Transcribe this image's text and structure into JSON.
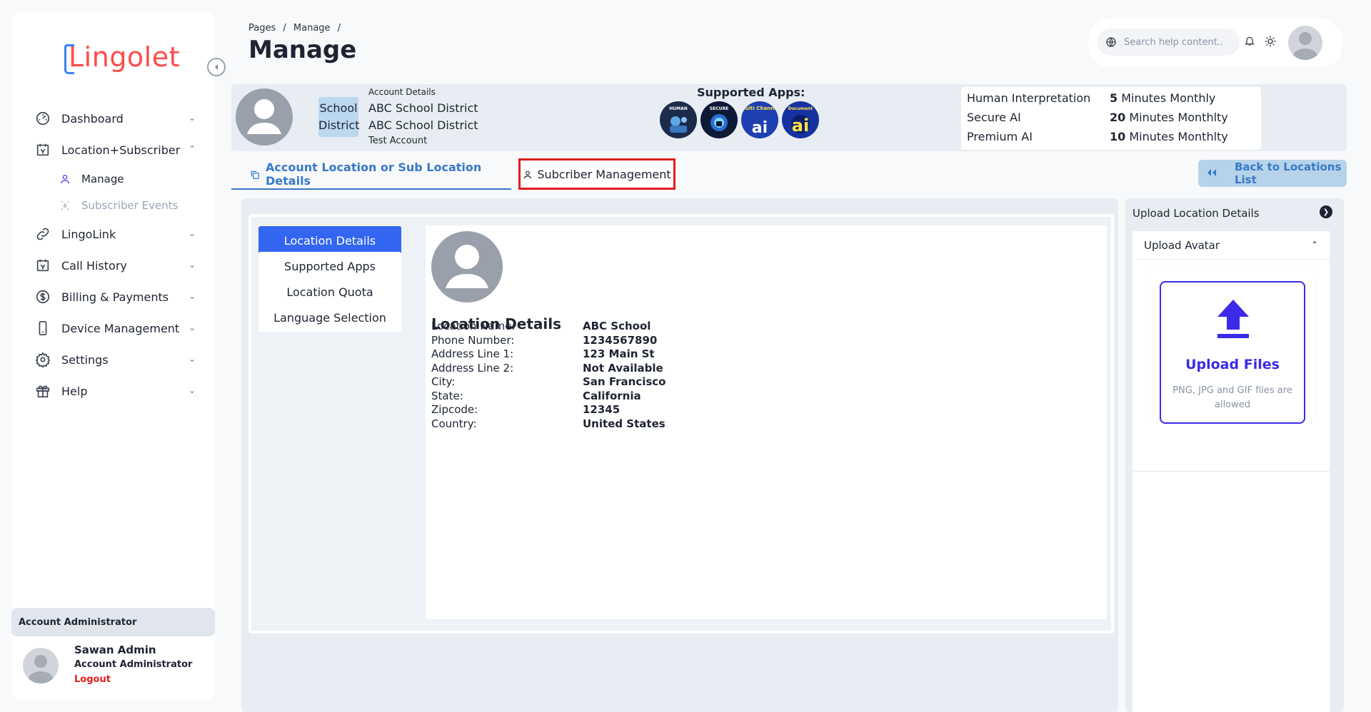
{
  "brand": {
    "logo_text": "Lingolet"
  },
  "sidebar": {
    "items": [
      {
        "label": "Dashboard",
        "icon": "gauge-icon",
        "expanded": false
      },
      {
        "label": "Location+Subscriber",
        "icon": "calendar-icon",
        "expanded": true
      },
      {
        "label": "LingoLink",
        "icon": "link-icon",
        "expanded": false
      },
      {
        "label": "Call History",
        "icon": "calendar-icon",
        "expanded": false
      },
      {
        "label": "Billing & Payments",
        "icon": "dollar-icon",
        "expanded": false
      },
      {
        "label": "Device Management",
        "icon": "phone-icon",
        "expanded": false
      },
      {
        "label": "Settings",
        "icon": "gear-icon",
        "expanded": false
      },
      {
        "label": "Help",
        "icon": "gift-icon",
        "expanded": false
      }
    ],
    "sub_items": [
      {
        "label": "Manage",
        "icon": "user-icon",
        "active": true
      },
      {
        "label": "Subscriber Events",
        "icon": "list-icon",
        "active": false
      }
    ],
    "role_label": "Account Administrator",
    "user": {
      "name": "Sawan Admin",
      "role": "Account Administrator",
      "logout": "Logout"
    }
  },
  "header": {
    "breadcrumb": [
      "Pages",
      "/",
      "Manage",
      "/"
    ],
    "title": "Manage",
    "search_placeholder": "Search help content.."
  },
  "account": {
    "type_line1": "School",
    "type_line2": "District",
    "details_label": "Account Details",
    "name_line1": "ABC School District",
    "name_line2": "ABC School District",
    "account_kind": "Test Account",
    "supported_apps_title": "Supported Apps:",
    "apps": [
      {
        "label": "HUMAN",
        "color": "#1c2b4a"
      },
      {
        "label": "SECURE",
        "color": "#0c1a36"
      },
      {
        "label": "ai",
        "top": "Multi Channel",
        "color": "#1d3fb0"
      },
      {
        "label": "ai",
        "top": "Document",
        "color": "#1532a0"
      }
    ],
    "quotas": [
      {
        "name": "Human Interpretation",
        "amount": "5",
        "unit": "Minutes Monthly"
      },
      {
        "name": "Secure AI",
        "amount": "20",
        "unit": "Minutes Monthlty"
      },
      {
        "name": "Premium AI",
        "amount": "10",
        "unit": "Minutes Monthlty"
      }
    ]
  },
  "tabs": {
    "location_tab": "Account Location or Sub Location Details",
    "subscriber_tab": "Subcriber Management",
    "back_button": "Back to Locations List"
  },
  "vertical_tabs": [
    {
      "label": "Location Details",
      "active": true
    },
    {
      "label": "Supported Apps",
      "active": false
    },
    {
      "label": "Location Quota",
      "active": false
    },
    {
      "label": "Language Selection",
      "active": false
    }
  ],
  "location_details": {
    "title": "Location Details",
    "fields": [
      {
        "label": "Location Name:",
        "value": "ABC School"
      },
      {
        "label": "Phone Number:",
        "value": "1234567890"
      },
      {
        "label": "Address Line 1:",
        "value": "123 Main St"
      },
      {
        "label": "Address Line 2:",
        "value": "Not Available"
      },
      {
        "label": "City:",
        "value": "San Francisco"
      },
      {
        "label": "State:",
        "value": "California"
      },
      {
        "label": "Zipcode:",
        "value": "12345"
      },
      {
        "label": "Country:",
        "value": "United States"
      }
    ]
  },
  "upload": {
    "panel_title": "Upload Location Details",
    "section_title": "Upload Avatar",
    "button_label": "Upload Files",
    "hint": "PNG, JPG and GIF files are allowed"
  },
  "colors": {
    "accent": "#3366f0",
    "link_blue": "#3778c8",
    "highlight_red": "#e11d1d",
    "upload_blue": "#3b2ae8"
  }
}
